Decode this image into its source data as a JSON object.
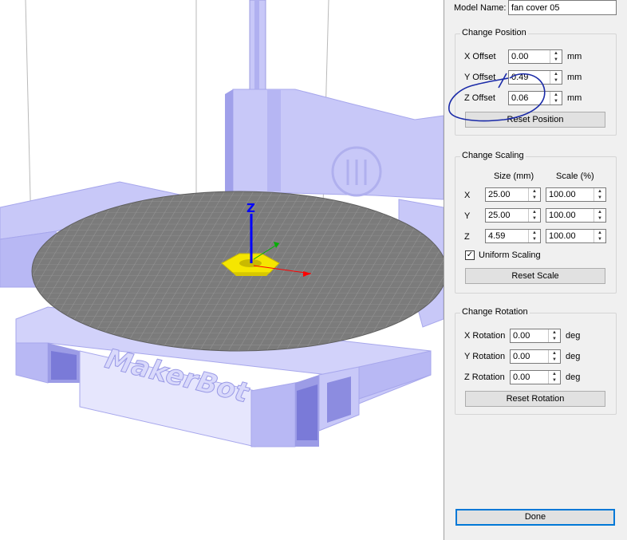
{
  "model": {
    "label": "Model Name:",
    "value": "fan cover 05"
  },
  "position": {
    "title": "Change Position",
    "rows": [
      {
        "label": "X Offset",
        "value": "0.00",
        "unit": "mm"
      },
      {
        "label": "Y Offset",
        "value": "0.49",
        "unit": "mm"
      },
      {
        "label": "Z Offset",
        "value": "0.06",
        "unit": "mm"
      }
    ],
    "reset_label": "Reset Position"
  },
  "scaling": {
    "title": "Change Scaling",
    "size_header": "Size (mm)",
    "scale_header": "Scale (%)",
    "rows": [
      {
        "axis": "X",
        "size": "25.00",
        "scale": "100.00"
      },
      {
        "axis": "Y",
        "size": "25.00",
        "scale": "100.00"
      },
      {
        "axis": "Z",
        "size": "4.59",
        "scale": "100.00"
      }
    ],
    "uniform_label": "Uniform Scaling",
    "uniform_checked": true,
    "reset_label": "Reset Scale"
  },
  "rotation": {
    "title": "Change Rotation",
    "rows": [
      {
        "label": "X Rotation",
        "value": "0.00",
        "unit": "deg"
      },
      {
        "label": "Y Rotation",
        "value": "0.00",
        "unit": "deg"
      },
      {
        "label": "Z Rotation",
        "value": "0.00",
        "unit": "deg"
      }
    ],
    "reset_label": "Reset Rotation"
  },
  "done_label": "Done",
  "viewport": {
    "brand_text": "MakerBot",
    "axis_label": "Z",
    "colors": {
      "printer_body": "#c8c8f8",
      "printer_shadow": "#a0a0ea",
      "plate": "#7b7b7b",
      "grid": "#9a9a9a",
      "model": "#f5e600",
      "axis_z": "#0000ff",
      "axis_x": "#ff0000",
      "axis_y": "#00b000",
      "annotation": "#1a2aa8"
    }
  }
}
